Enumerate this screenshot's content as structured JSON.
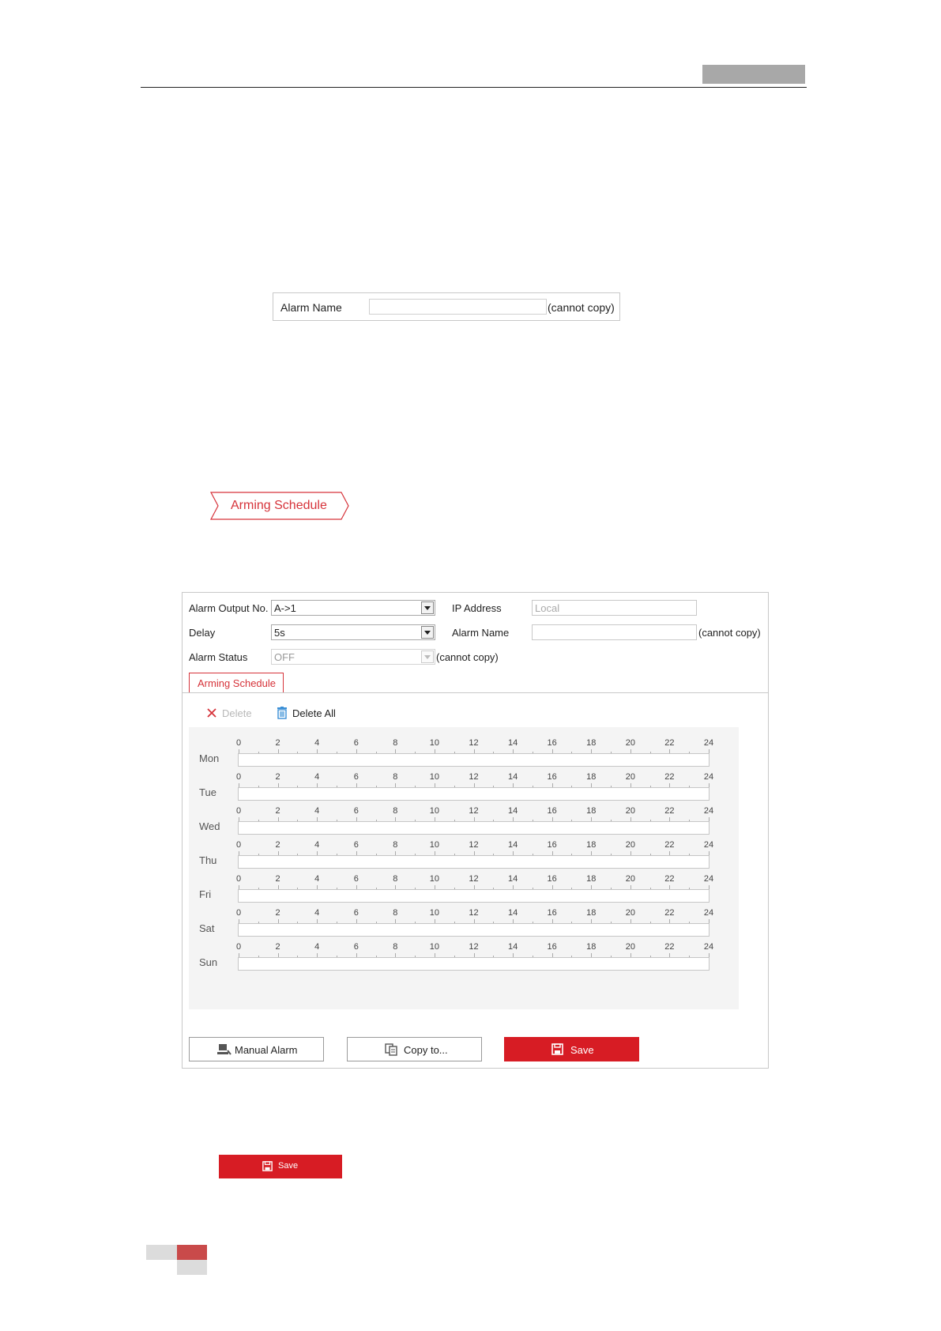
{
  "alarm_name_field": {
    "label": "Alarm Name",
    "value": "",
    "note": "(cannot copy)"
  },
  "arming_tag": {
    "label": "Arming Schedule"
  },
  "panel": {
    "alarm_output_no": {
      "label": "Alarm Output No.",
      "value": "A->1"
    },
    "delay": {
      "label": "Delay",
      "value": "5s"
    },
    "alarm_status": {
      "label": "Alarm Status",
      "value": "OFF",
      "note": "(cannot copy)"
    },
    "ip_address": {
      "label": "IP Address",
      "value": "Local"
    },
    "alarm_name": {
      "label": "Alarm Name",
      "value": "",
      "note": "(cannot copy)"
    },
    "tab_label": "Arming Schedule",
    "delete_label": "Delete",
    "delete_all_label": "Delete All",
    "days": [
      "Mon",
      "Tue",
      "Wed",
      "Thu",
      "Fri",
      "Sat",
      "Sun"
    ],
    "hour_ticks": [
      "0",
      "2",
      "4",
      "6",
      "8",
      "10",
      "12",
      "14",
      "16",
      "18",
      "20",
      "22",
      "24"
    ],
    "manual_alarm_label": "Manual Alarm",
    "copy_to_label": "Copy to...",
    "save_label": "Save"
  },
  "bottom_save": {
    "label": "Save"
  },
  "colors": {
    "accent": "#d71c24",
    "tag_red": "#d6333a",
    "footer_red": "#c94a4a",
    "header_gray": "#a8a8a8"
  }
}
